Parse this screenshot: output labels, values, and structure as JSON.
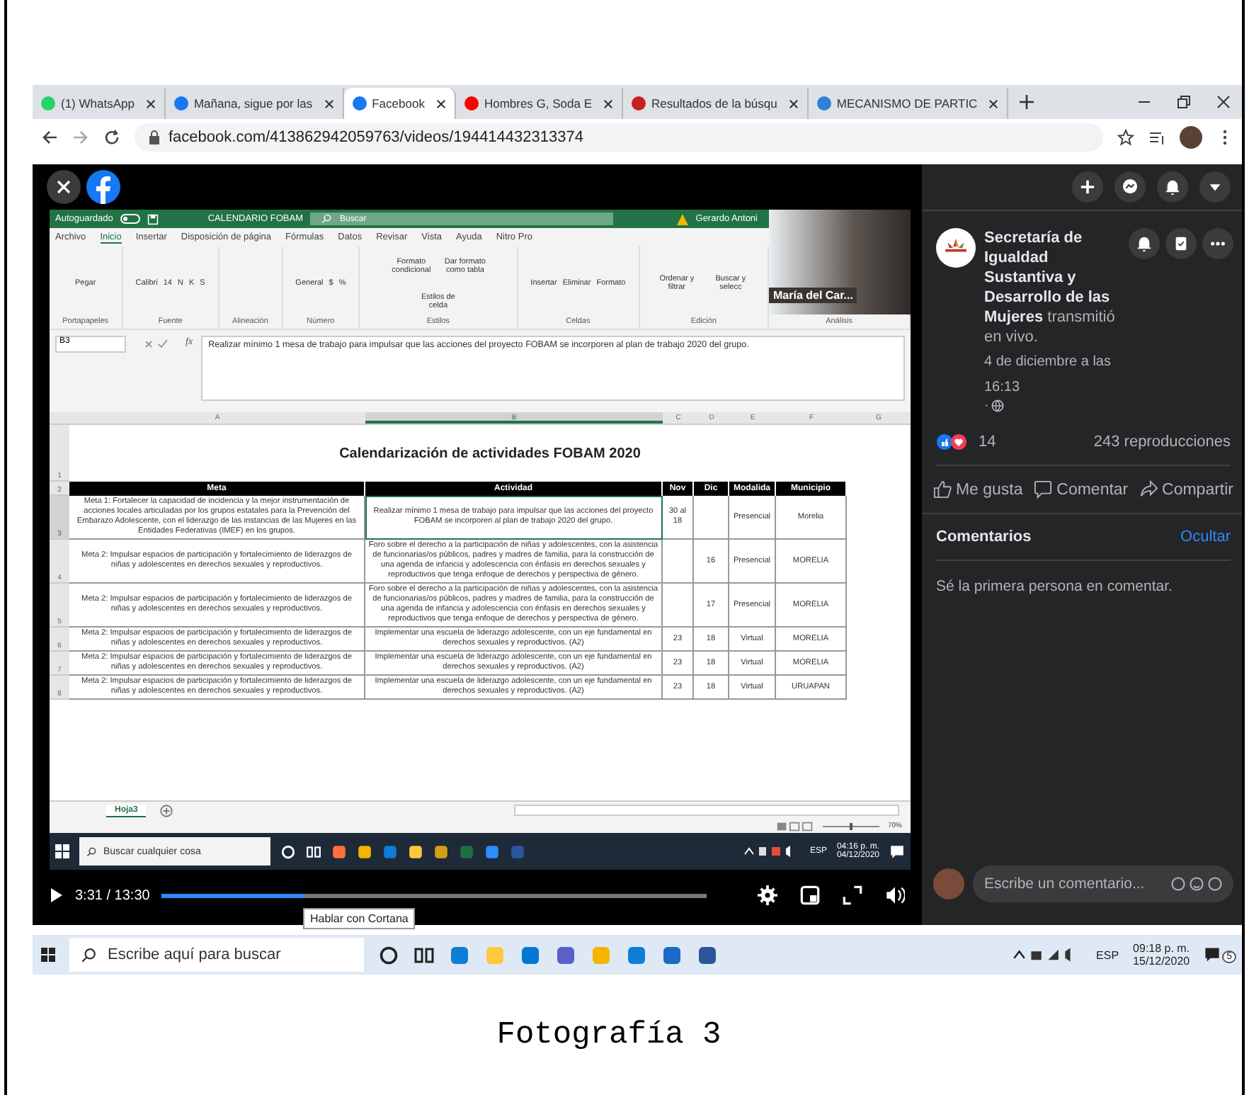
{
  "browser": {
    "tabs": [
      {
        "label": "(1) WhatsApp",
        "selected": false,
        "color": "#25d366"
      },
      {
        "label": "Mañana, sigue por las",
        "selected": false,
        "color": "#1877f2"
      },
      {
        "label": "Facebook",
        "selected": true,
        "color": "#1877f2"
      },
      {
        "label": "Hombres G, Soda E",
        "selected": false,
        "color": "#ff0000"
      },
      {
        "label": "Resultados de la búsqu",
        "selected": false,
        "color": "#c5221f"
      },
      {
        "label": "MECANISMO DE PARTIC",
        "selected": false,
        "color": "#2f7fd6"
      }
    ],
    "url": "facebook.com/413862942059763/videos/194414432313374"
  },
  "excel": {
    "autosave_label": "Autoguardado",
    "autosave_on": false,
    "file_name": "CALENDARIO FOBAM",
    "search_placeholder": "Buscar",
    "user": "Gerardo Antoni",
    "menu": [
      {
        "label": "Archivo",
        "selected": false
      },
      {
        "label": "Inicio",
        "selected": true
      },
      {
        "label": "Insertar",
        "selected": false
      },
      {
        "label": "Disposición de página",
        "selected": false
      },
      {
        "label": "Fórmulas",
        "selected": false
      },
      {
        "label": "Datos",
        "selected": false
      },
      {
        "label": "Revisar",
        "selected": false
      },
      {
        "label": "Vista",
        "selected": false
      },
      {
        "label": "Ayuda",
        "selected": false
      },
      {
        "label": "Nitro Pro",
        "selected": false
      }
    ],
    "ribbon_groups": [
      {
        "label": "Portapapeles",
        "items": [
          "Pegar"
        ]
      },
      {
        "label": "Fuente",
        "items": [
          "Calibri",
          "14",
          "N",
          "K",
          "S"
        ]
      },
      {
        "label": "Alineación"
      },
      {
        "label": "Número",
        "items": [
          "General",
          "$",
          "%"
        ]
      },
      {
        "label": "Estilos",
        "items": [
          "Formato condicional",
          "Dar formato como tabla",
          "Estilos de celda"
        ]
      },
      {
        "label": "Celdas",
        "items": [
          "Insertar",
          "Eliminar",
          "Formato"
        ]
      },
      {
        "label": "Edición",
        "items": [
          "Ordenar y filtrar",
          "Buscar y selecc"
        ]
      },
      {
        "label": "Análisis"
      }
    ],
    "name_box": "B3",
    "function_label": "fx",
    "formula": "Realizar mínimo 1 mesa de trabajo para impulsar que las acciones del proyecto FOBAM se incorporen al plan de trabajo 2020 del grupo.",
    "columns": [
      {
        "label": "A",
        "selected": false
      },
      {
        "label": "B",
        "selected": true
      },
      {
        "label": "C",
        "selected": false
      },
      {
        "label": "D",
        "selected": false
      },
      {
        "label": "E",
        "selected": false
      },
      {
        "label": "F",
        "selected": false
      },
      {
        "label": "G",
        "selected": false
      }
    ],
    "title_row": "1",
    "title": "Calendarización de actividades FOBAM 2020",
    "header_row": "2",
    "headers": [
      "Meta",
      "Actividad",
      "Nov",
      "Dic",
      "Modalida",
      "Municipio"
    ],
    "rows": [
      {
        "number": "3",
        "selected": true,
        "cells": [
          "Meta 1: Fortalecer la capacidad de incidencia y la mejor instrumentación de acciones locales articuladas por los grupos estatales para la Prevención del Embarazo Adolescente, con el liderazgo de las instancias de las Mujeres en las Entidades Federativas (IMEF) en los grupos.",
          "Realizar mínimo 1 mesa de trabajo para impulsar que las acciones del proyecto FOBAM se incorporen al plan de trabajo 2020 del grupo.",
          "30 al 18",
          "",
          "Presencial",
          "Morelia"
        ]
      },
      {
        "number": "4",
        "selected": false,
        "cells": [
          "Meta 2: Impulsar espacios de participación y fortalecimiento de liderazgos de niñas y adolescentes en derechos sexuales y reproductivos.",
          "Foro sobre el derecho a la participación de niñas y adolescentes, con la asistencia de funcionarias/os públicos, padres y madres de familia, para la construcción de una agenda de infancia y adolescencia con énfasis en derechos sexuales y reproductivos que tenga enfoque de derechos y perspectiva de género.",
          "",
          "16",
          "Presencial",
          "MORELIA"
        ]
      },
      {
        "number": "5",
        "selected": false,
        "cells": [
          "Meta 2: Impulsar espacios de participación y fortalecimiento de liderazgos de niñas y adolescentes en derechos sexuales y reproductivos.",
          "Foro sobre el derecho a la participación de niñas y adolescentes, con la asistencia de funcionarias/os públicos, padres y madres de familia, para la construcción de una agenda de infancia y adolescencia con énfasis en derechos sexuales y reproductivos que tenga enfoque de derechos y perspectiva de género.",
          "",
          "17",
          "Presencial",
          "MORELIA"
        ]
      },
      {
        "number": "6",
        "selected": false,
        "cells": [
          "Meta 2: Impulsar espacios de participación y fortalecimiento de liderazgos de niñas y adolescentes en derechos sexuales y reproductivos.",
          "Implementar una escuela de liderazgo adolescente, con un eje fundamental en derechos sexuales y reproductivos. (A2)",
          "23",
          "18",
          "Virtual",
          "MORELIA"
        ]
      },
      {
        "number": "7",
        "selected": false,
        "cells": [
          "Meta 2: Impulsar espacios de participación y fortalecimiento de liderazgos de niñas y adolescentes en derechos sexuales y reproductivos.",
          "Implementar una escuela de liderazgo adolescente, con un eje fundamental en derechos sexuales y reproductivos. (A2)",
          "23",
          "18",
          "Virtual",
          "MORELIA"
        ]
      },
      {
        "number": "8",
        "selected": false,
        "cells": [
          "Meta 2: Impulsar espacios de participación y fortalecimiento de liderazgos de niñas y adolescentes en derechos sexuales y reproductivos.",
          "Implementar una escuela de liderazgo adolescente, con un eje fundamental en derechos sexuales y reproductivos. (A2)",
          "23",
          "18",
          "Virtual",
          "URUAPAN"
        ]
      }
    ],
    "sheet_tab": "Hoja3",
    "zoom_slider": {
      "level": 0.5
    },
    "zoom_level": "70%"
  },
  "participant": {
    "name": "María del Car..."
  },
  "inner_taskbar": {
    "search_placeholder": "Buscar cualquier cosa",
    "lang": "ESP",
    "time": "04:16 p. m.",
    "date": "04/12/2020"
  },
  "player": {
    "time": "3:31 / 13:30",
    "level": 0.26,
    "tooltip": "Hablar con Cortana"
  },
  "panel": {
    "page_name": "Secretaría de Igualdad Sustantiva y Desarrollo de las Mujeres",
    "action": "transmitió en vivo.",
    "date": "4 de diciembre a las 16:13",
    "separator": "·",
    "reactions": "14",
    "views": "243 reproducciones",
    "buttons": [
      "Me gusta",
      "Comentar",
      "Compartir"
    ],
    "comments_title": "Comentarios",
    "hide_link": "Ocultar",
    "empty_text": "Sé la primera persona en comentar.",
    "comment_placeholder": "Escribe un comentario..."
  },
  "taskbar": {
    "search_placeholder": "Escribe aquí para buscar",
    "lang": "ESP",
    "time": "09:18 p. m.",
    "date": "15/12/2020",
    "notifications": "5"
  },
  "caption": "Fotografía 3"
}
